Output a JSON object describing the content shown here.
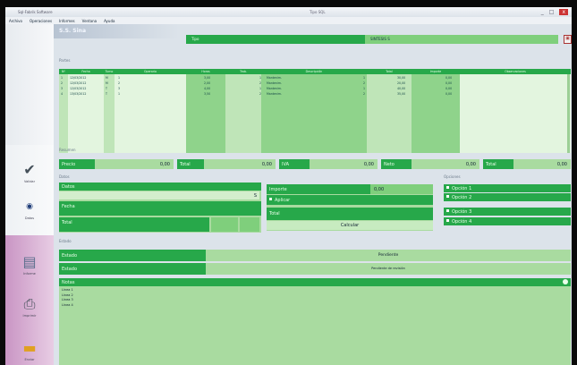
{
  "window": {
    "app_title": "Sql-Fabrik Software",
    "doc_title": "Tipo SQL",
    "buttons": [
      "_",
      "□",
      "x"
    ]
  },
  "menu": [
    "Archivo",
    "Operaciones",
    "Informes",
    "Ventana",
    "Ayuda"
  ],
  "header": {
    "title": "S.S. Sina",
    "label": "Tipo",
    "value": "SINTESIS S"
  },
  "table": {
    "section": "Partes",
    "headers": [
      "Nº",
      "Fecha",
      "Turno",
      "Operario",
      "Horas",
      "Trab.",
      "Descripción",
      "Total",
      "Importe",
      "Observaciones"
    ],
    "rows": [
      [
        "1",
        "12/03/2012",
        "M",
        "1",
        "3,00",
        "1",
        "Mantenim.",
        "1",
        "30,00",
        "0,00"
      ],
      [
        "2",
        "12/03/2012",
        "M",
        "2",
        "2,00",
        "2",
        "Mantenim.",
        "2",
        "20,00",
        "0,00"
      ],
      [
        "3",
        "12/03/2012",
        "T",
        "3",
        "4,00",
        "1",
        "Mantenim.",
        "1",
        "40,00",
        "0,00"
      ],
      [
        "4",
        "13/03/2012",
        "T",
        "1",
        "3,50",
        "2",
        "Mantenim.",
        "2",
        "35,00",
        "0,00"
      ]
    ]
  },
  "totals": {
    "section": "Resumen",
    "fields": [
      {
        "label": "Precio",
        "value": "0,00"
      },
      {
        "label": "Total",
        "value": "0,00"
      },
      {
        "label": "IVA",
        "value": "0,00"
      },
      {
        "label": "Neto",
        "value": "0,00"
      },
      {
        "label": "Total",
        "value": "0,00"
      }
    ]
  },
  "panels": {
    "left_section": "Datos",
    "left_header": "Datos",
    "left_select": "S",
    "left_rows": [
      "Fecha",
      "Total"
    ],
    "mid_label1": "Importe",
    "mid_value1": "0,00",
    "mid_check": "Aplicar",
    "mid_label2": "Total",
    "mid_button": "Calcular",
    "right_section": "Opciones",
    "right_items": [
      "Opción 1",
      "Opción 2",
      "Opción 3",
      "Opción 4"
    ]
  },
  "status": {
    "section": "Estado",
    "row1_label": "Estado",
    "row1_value": "Pendiente",
    "row2_label": "Estado",
    "row2_value": "Pendiente de revisión",
    "notes_title": "Notas",
    "notes_lines": [
      "Línea 1",
      "Línea 2",
      "Línea 3",
      "Línea 4"
    ]
  },
  "sidebar": {
    "items": [
      {
        "label": "Validar",
        "icon": "check-icon"
      },
      {
        "label": "Datos",
        "icon": "logo-icon"
      },
      {
        "label": "Informe",
        "icon": "document-icon"
      },
      {
        "label": "Imprimir",
        "icon": "printer-icon"
      },
      {
        "label": "Enviar",
        "icon": "box-icon"
      }
    ]
  }
}
